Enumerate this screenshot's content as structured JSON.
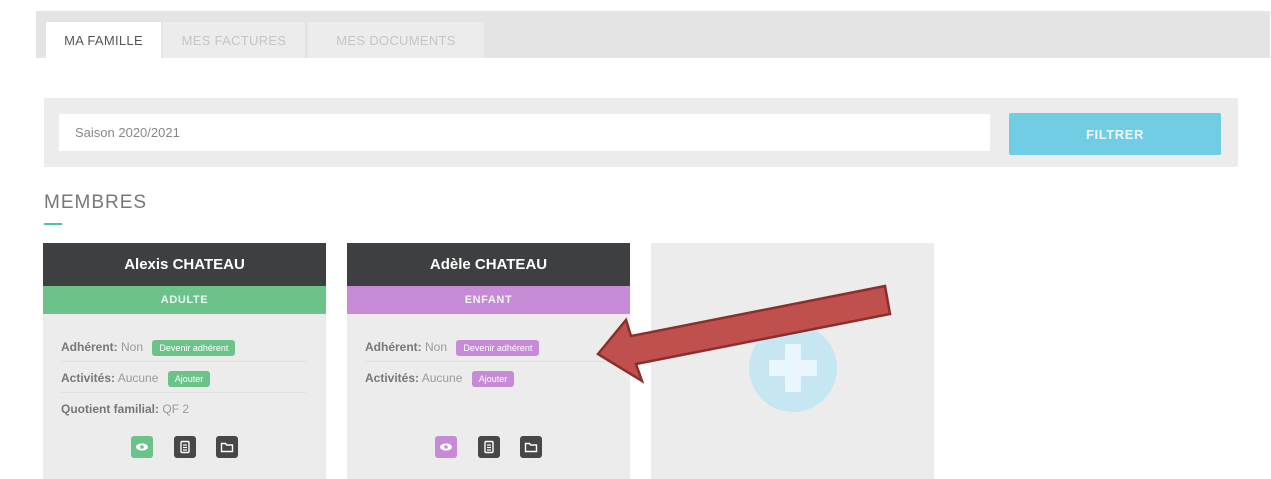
{
  "tabs": [
    {
      "label": "MA FAMILLE",
      "active": true
    },
    {
      "label": "MES FACTURES",
      "active": false
    },
    {
      "label": "MES DOCUMENTS",
      "active": false
    }
  ],
  "filter": {
    "season_value": "Saison 2020/2021",
    "button_label": "FILTRER"
  },
  "section": {
    "title": "MEMBRES"
  },
  "members": [
    {
      "name": "Alexis CHATEAU",
      "type": "ADULTE",
      "color": "#6cc38a",
      "adherent_label": "Adhérent:",
      "adherent_value": "Non",
      "adherent_action": "Devenir adhérent",
      "activities_label": "Activités:",
      "activities_value": "Aucune",
      "activities_action": "Ajouter",
      "quotient_label": "Quotient familial:",
      "quotient_value": "QF 2",
      "icons": [
        "eye-icon",
        "document-icon",
        "folder-icon"
      ]
    },
    {
      "name": "Adèle CHATEAU",
      "type": "ENFANT",
      "color": "#c68ad6",
      "adherent_label": "Adhérent:",
      "adherent_value": "Non",
      "adherent_action": "Devenir adhérent",
      "activities_label": "Activités:",
      "activities_value": "Aucune",
      "activities_action": "Ajouter",
      "icons": [
        "eye-icon",
        "document-icon",
        "folder-icon"
      ]
    }
  ],
  "add_member": {
    "icon": "plus-icon"
  },
  "annotation": {
    "arrow_color": "#c0504d"
  },
  "colors": {
    "accent_blue": "#70cde3",
    "card_header": "#3d3f41",
    "tab_bar": "#e4e4e4"
  }
}
